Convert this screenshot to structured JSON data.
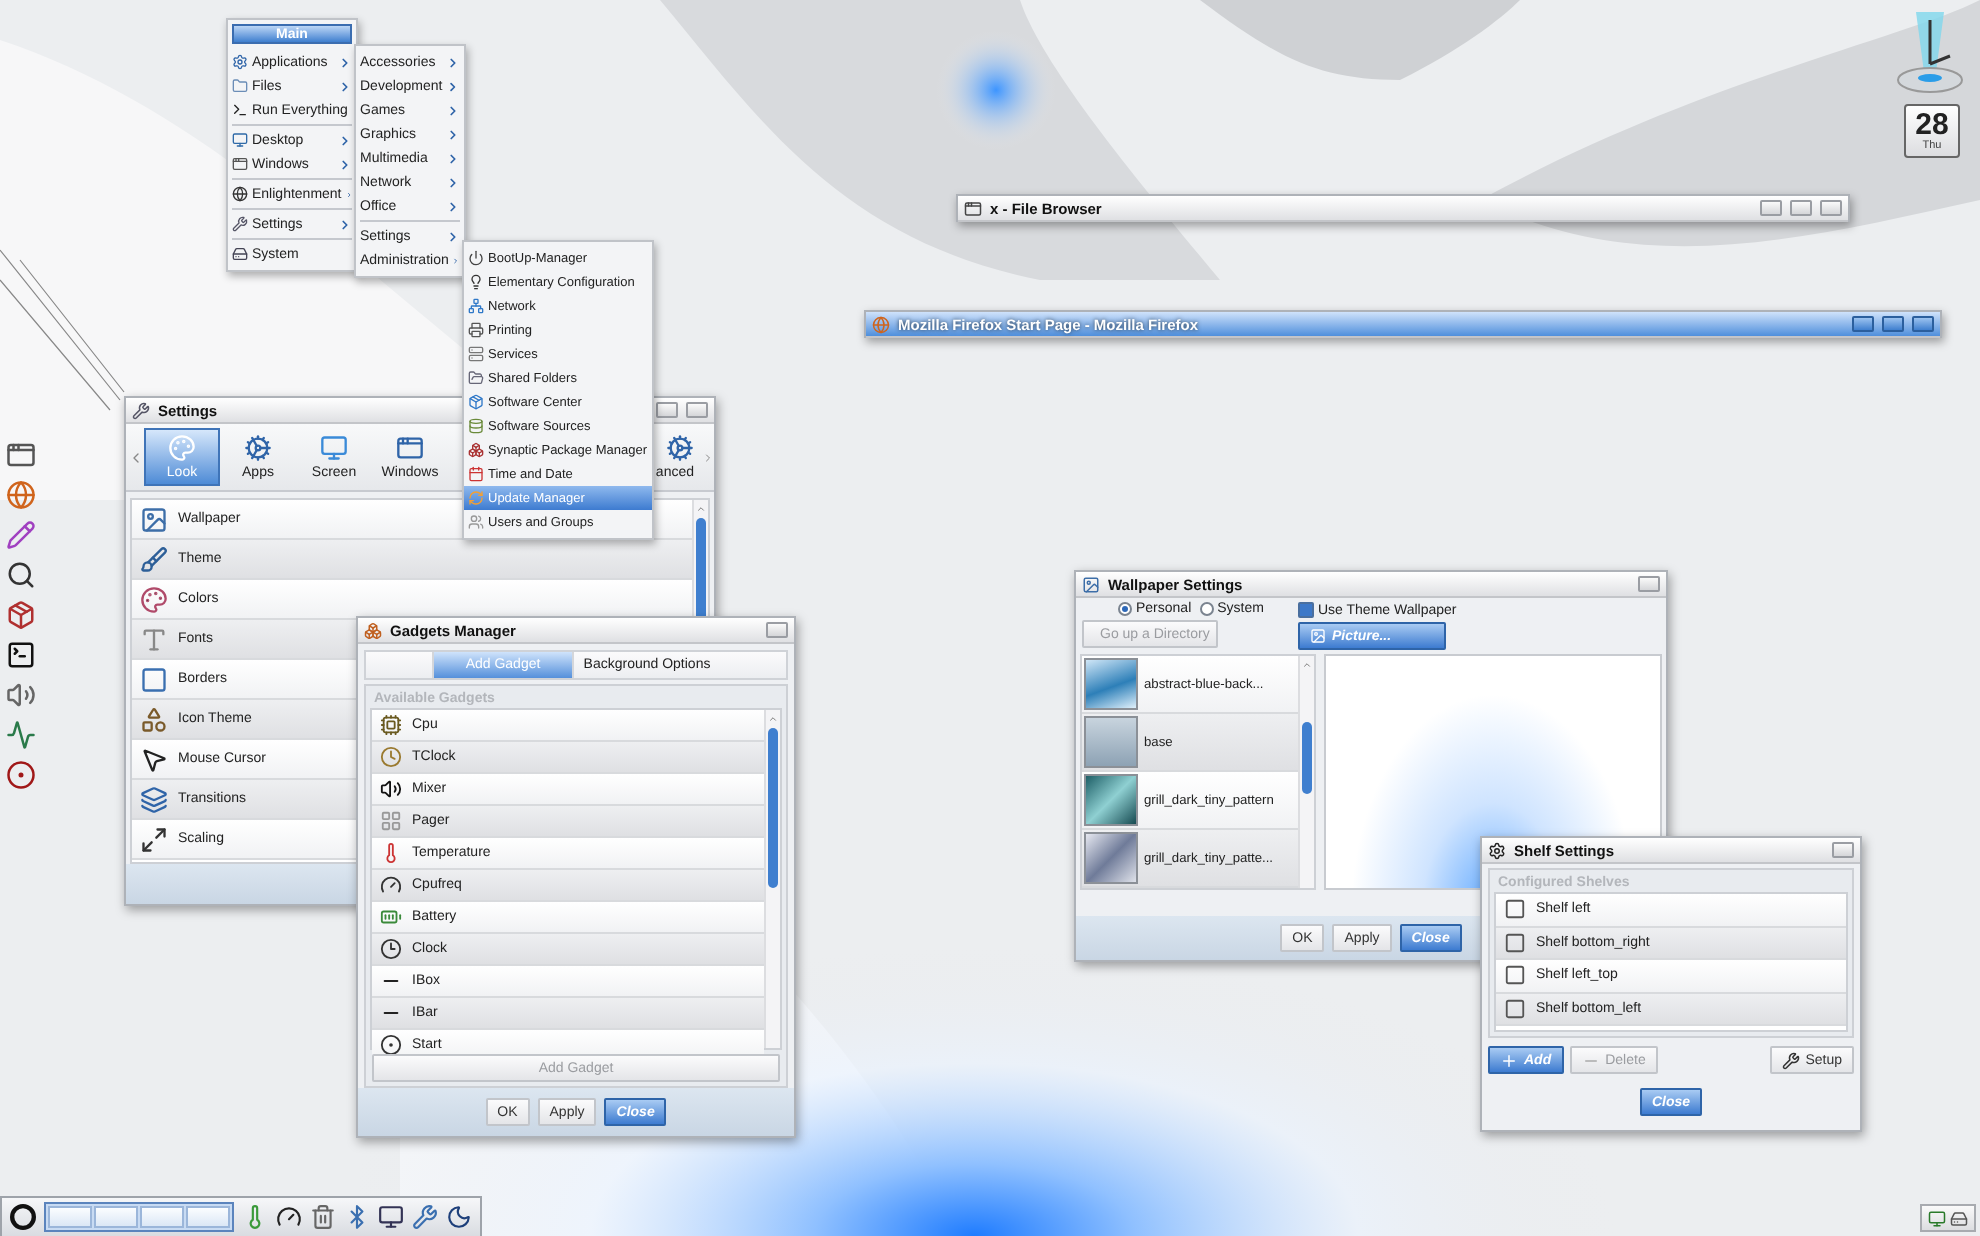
{
  "main_menu": {
    "title": "Main",
    "groups": [
      [
        {
          "label": "Applications",
          "submenu": true
        },
        {
          "label": "Files",
          "submenu": true
        },
        {
          "label": "Run Everything",
          "submenu": false
        }
      ],
      [
        {
          "label": "Desktop",
          "submenu": true
        },
        {
          "label": "Windows",
          "submenu": true
        }
      ],
      [
        {
          "label": "Enlightenment",
          "submenu": true
        }
      ],
      [
        {
          "label": "Settings",
          "submenu": true
        }
      ],
      [
        {
          "label": "System",
          "submenu": false
        }
      ]
    ]
  },
  "applications_menu": {
    "groups": [
      [
        {
          "label": "Accessories",
          "submenu": true
        },
        {
          "label": "Development",
          "submenu": true
        },
        {
          "label": "Games",
          "submenu": true
        },
        {
          "label": "Graphics",
          "submenu": true
        },
        {
          "label": "Multimedia",
          "submenu": true
        },
        {
          "label": "Network",
          "submenu": true
        },
        {
          "label": "Office",
          "submenu": true
        }
      ],
      [
        {
          "label": "Settings",
          "submenu": true
        },
        {
          "label": "Administration",
          "submenu": true
        }
      ]
    ]
  },
  "administration_menu": {
    "items": [
      {
        "label": "BootUp-Manager",
        "selected": false
      },
      {
        "label": "Elementary Configuration",
        "selected": false
      },
      {
        "label": "Network",
        "selected": false
      },
      {
        "label": "Printing",
        "selected": false
      },
      {
        "label": "Services",
        "selected": false
      },
      {
        "label": "Shared Folders",
        "selected": false
      },
      {
        "label": "Software Center",
        "selected": false
      },
      {
        "label": "Software Sources",
        "selected": false
      },
      {
        "label": "Synaptic Package Manager",
        "selected": false
      },
      {
        "label": "Time and Date",
        "selected": false
      },
      {
        "label": "Update Manager",
        "selected": true
      },
      {
        "label": "Users and Groups",
        "selected": false
      }
    ]
  },
  "shaded_windows": [
    {
      "title": "x - File Browser",
      "focused": false
    },
    {
      "title": "Mozilla Firefox Start Page - Mozilla Firefox",
      "focused": true
    }
  ],
  "calendar": {
    "day": "28",
    "weekday": "Thu"
  },
  "settings_window": {
    "title": "Settings",
    "tabs": [
      {
        "label": "Look",
        "selected": true
      },
      {
        "label": "Apps",
        "selected": false
      },
      {
        "label": "Screen",
        "selected": false
      },
      {
        "label": "Windows",
        "selected": false
      },
      {
        "label": "anced",
        "selected": false
      }
    ],
    "items": [
      "Wallpaper",
      "Theme",
      "Colors",
      "Fonts",
      "Borders",
      "Icon Theme",
      "Mouse Cursor",
      "Transitions",
      "Scaling"
    ]
  },
  "gadgets_window": {
    "title": "Gadgets Manager",
    "tabs": [
      {
        "label": "Add Gadget",
        "selected": true
      },
      {
        "label": "Background Options",
        "selected": false
      }
    ],
    "section": "Available Gadgets",
    "gadgets": [
      "Cpu",
      "TClock",
      "Mixer",
      "Pager",
      "Temperature",
      "Cpufreq",
      "Battery",
      "Clock",
      "IBox",
      "IBar",
      "Start"
    ],
    "add_button": {
      "label": "Add Gadget",
      "disabled": true
    },
    "buttons": [
      {
        "label": "OK",
        "default": false
      },
      {
        "label": "Apply",
        "default": false
      },
      {
        "label": "Close",
        "default": true
      }
    ]
  },
  "wallpaper_window": {
    "title": "Wallpaper Settings",
    "radios": [
      {
        "label": "Personal",
        "selected": true
      },
      {
        "label": "System",
        "selected": false
      }
    ],
    "theme_checkbox": {
      "label": "Use Theme Wallpaper",
      "checked": true
    },
    "up_button": {
      "label": "Go up a Directory",
      "disabled": true
    },
    "picture_button": {
      "label": "Picture..."
    },
    "files": [
      "abstract-blue-back...",
      "base",
      "grill_dark_tiny_pattern",
      "grill_dark_tiny_patte..."
    ],
    "buttons": [
      {
        "label": "OK",
        "default": false
      },
      {
        "label": "Apply",
        "default": false
      },
      {
        "label": "Close",
        "default": true
      }
    ]
  },
  "shelf_window": {
    "title": "Shelf Settings",
    "section": "Configured Shelves",
    "shelves": [
      "Shelf left",
      "Shelf bottom_right",
      "Shelf left_top",
      "Shelf bottom_left"
    ],
    "buttons": [
      {
        "label": "Add",
        "kind": "add",
        "default": true,
        "disabled": false
      },
      {
        "label": "Delete",
        "kind": "delete",
        "default": false,
        "disabled": true
      },
      {
        "label": "Setup",
        "kind": "setup",
        "default": false,
        "disabled": false
      }
    ],
    "close_button": {
      "label": "Close",
      "default": true
    }
  }
}
